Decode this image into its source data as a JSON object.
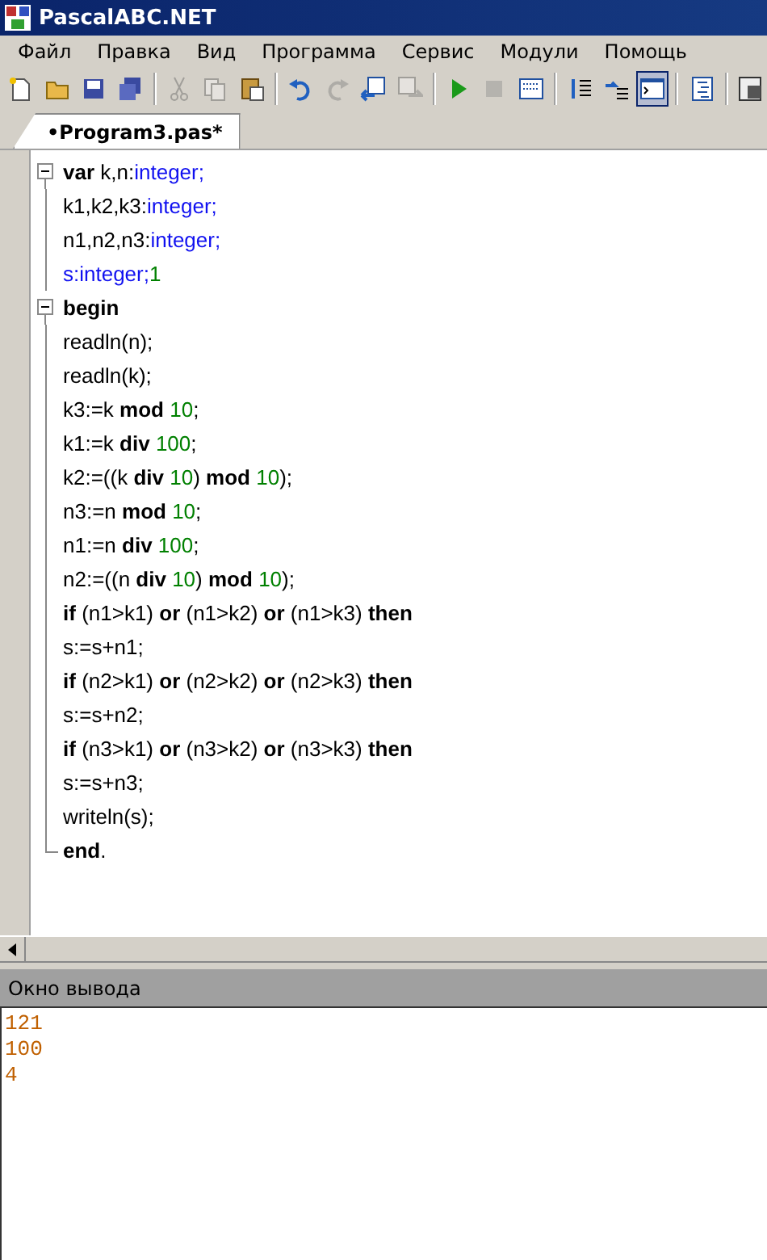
{
  "window": {
    "title": "PascalABC.NET"
  },
  "menu": [
    "Файл",
    "Правка",
    "Вид",
    "Программа",
    "Сервис",
    "Модули",
    "Помощь"
  ],
  "toolbar": [
    {
      "kind": "new",
      "disabled": false,
      "pressed": false
    },
    {
      "kind": "open",
      "disabled": false,
      "pressed": false
    },
    {
      "kind": "save",
      "disabled": false,
      "pressed": false
    },
    {
      "kind": "saveall",
      "disabled": false,
      "pressed": false
    },
    {
      "kind": "sep"
    },
    {
      "kind": "cut",
      "disabled": true,
      "pressed": false
    },
    {
      "kind": "copy",
      "disabled": true,
      "pressed": false
    },
    {
      "kind": "paste",
      "disabled": false,
      "pressed": false
    },
    {
      "kind": "sep"
    },
    {
      "kind": "undo",
      "disabled": false,
      "pressed": false
    },
    {
      "kind": "redo",
      "disabled": true,
      "pressed": false
    },
    {
      "kind": "import",
      "disabled": false,
      "pressed": false
    },
    {
      "kind": "export",
      "disabled": true,
      "pressed": false
    },
    {
      "kind": "sep"
    },
    {
      "kind": "run",
      "disabled": false,
      "pressed": false
    },
    {
      "kind": "stop",
      "disabled": true,
      "pressed": false
    },
    {
      "kind": "compile",
      "disabled": false,
      "pressed": false
    },
    {
      "kind": "sep"
    },
    {
      "kind": "stepin",
      "disabled": false,
      "pressed": false
    },
    {
      "kind": "stepover",
      "disabled": false,
      "pressed": false
    },
    {
      "kind": "console",
      "disabled": false,
      "pressed": true
    },
    {
      "kind": "sep"
    },
    {
      "kind": "list",
      "disabled": false,
      "pressed": false
    },
    {
      "kind": "sep"
    },
    {
      "kind": "doc",
      "disabled": false,
      "pressed": false
    }
  ],
  "tabs": [
    {
      "label": "•Program3.pas*",
      "selected": true
    }
  ],
  "editor": {
    "lines": [
      {
        "kind": "block_start",
        "tokens": [
          {
            "kind": "keyword",
            "text": "var"
          },
          {
            "kind": "plain",
            "text": " k,n:"
          },
          {
            "kind": "type",
            "text": "integer;"
          }
        ]
      },
      {
        "tokens": [
          {
            "kind": "plain",
            "text": "k1,k2,k3:"
          },
          {
            "kind": "type",
            "text": "integer;"
          }
        ]
      },
      {
        "tokens": [
          {
            "kind": "plain",
            "text": "n1,n2,n3:"
          },
          {
            "kind": "type",
            "text": "integer;"
          }
        ]
      },
      {
        "tokens": [
          {
            "kind": "type",
            "text": "s:integer;"
          },
          {
            "kind": "number",
            "text": "1"
          }
        ]
      },
      {
        "kind": "block_start",
        "tokens": [
          {
            "kind": "keyword",
            "text": "begin"
          }
        ]
      },
      {
        "tokens": [
          {
            "kind": "plain",
            "text": "readln(n);"
          }
        ]
      },
      {
        "tokens": [
          {
            "kind": "plain",
            "text": "readln(k);"
          }
        ]
      },
      {
        "tokens": [
          {
            "kind": "plain",
            "text": "k3:=k "
          },
          {
            "kind": "keyword",
            "text": "mod"
          },
          {
            "kind": "number",
            "text": " 10"
          },
          {
            "kind": "plain",
            "text": ";"
          }
        ]
      },
      {
        "tokens": [
          {
            "kind": "plain",
            "text": "k1:=k "
          },
          {
            "kind": "keyword",
            "text": "div"
          },
          {
            "kind": "number",
            "text": " 100"
          },
          {
            "kind": "plain",
            "text": ";"
          }
        ]
      },
      {
        "tokens": [
          {
            "kind": "plain",
            "text": "k2:=((k "
          },
          {
            "kind": "keyword",
            "text": "div"
          },
          {
            "kind": "number",
            "text": " 10"
          },
          {
            "kind": "plain",
            "text": ") "
          },
          {
            "kind": "keyword",
            "text": "mod"
          },
          {
            "kind": "number",
            "text": " 10"
          },
          {
            "kind": "plain",
            "text": ");"
          }
        ]
      },
      {
        "tokens": [
          {
            "kind": "plain",
            "text": "n3:=n "
          },
          {
            "kind": "keyword",
            "text": "mod"
          },
          {
            "kind": "number",
            "text": " 10"
          },
          {
            "kind": "plain",
            "text": ";"
          }
        ]
      },
      {
        "tokens": [
          {
            "kind": "plain",
            "text": "n1:=n "
          },
          {
            "kind": "keyword",
            "text": "div"
          },
          {
            "kind": "number",
            "text": " 100"
          },
          {
            "kind": "plain",
            "text": ";"
          }
        ]
      },
      {
        "tokens": [
          {
            "kind": "plain",
            "text": "n2:=((n "
          },
          {
            "kind": "keyword",
            "text": "div"
          },
          {
            "kind": "number",
            "text": " 10"
          },
          {
            "kind": "plain",
            "text": ") "
          },
          {
            "kind": "keyword",
            "text": "mod"
          },
          {
            "kind": "number",
            "text": " 10"
          },
          {
            "kind": "plain",
            "text": ");"
          }
        ]
      },
      {
        "tokens": [
          {
            "kind": "keyword",
            "text": "if"
          },
          {
            "kind": "plain",
            "text": " (n1>k1) "
          },
          {
            "kind": "keyword",
            "text": "or"
          },
          {
            "kind": "plain",
            "text": " (n1>k2) "
          },
          {
            "kind": "keyword",
            "text": "or"
          },
          {
            "kind": "plain",
            "text": " (n1>k3) "
          },
          {
            "kind": "keyword",
            "text": "then"
          }
        ]
      },
      {
        "tokens": [
          {
            "kind": "plain",
            "text": "s:=s+n1;"
          }
        ]
      },
      {
        "tokens": [
          {
            "kind": "keyword",
            "text": "if"
          },
          {
            "kind": "plain",
            "text": " (n2>k1) "
          },
          {
            "kind": "keyword",
            "text": "or"
          },
          {
            "kind": "plain",
            "text": " (n2>k2) "
          },
          {
            "kind": "keyword",
            "text": "or"
          },
          {
            "kind": "plain",
            "text": " (n2>k3) "
          },
          {
            "kind": "keyword",
            "text": "then"
          }
        ]
      },
      {
        "tokens": [
          {
            "kind": "plain",
            "text": "s:=s+n2;"
          }
        ]
      },
      {
        "tokens": [
          {
            "kind": "keyword",
            "text": "if"
          },
          {
            "kind": "plain",
            "text": " (n3>k1) "
          },
          {
            "kind": "keyword",
            "text": "or"
          },
          {
            "kind": "plain",
            "text": " (n3>k2) "
          },
          {
            "kind": "keyword",
            "text": "or"
          },
          {
            "kind": "plain",
            "text": " (n3>k3) "
          },
          {
            "kind": "keyword",
            "text": "then"
          }
        ]
      },
      {
        "tokens": [
          {
            "kind": "plain",
            "text": "s:=s+n3;"
          }
        ]
      },
      {
        "tokens": [
          {
            "kind": "plain",
            "text": "writeln(s);"
          }
        ]
      },
      {
        "kind": "block_end",
        "tokens": [
          {
            "kind": "keyword",
            "text": "end"
          },
          {
            "kind": "plain",
            "text": "."
          }
        ]
      }
    ]
  },
  "output": {
    "title": "Окно вывода",
    "lines": [
      "121",
      "100",
      "4"
    ]
  }
}
